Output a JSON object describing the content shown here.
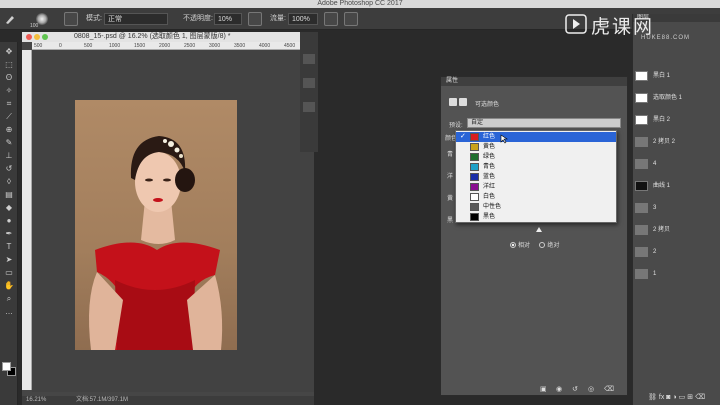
{
  "app": {
    "window_title": "Adobe Photoshop CC 2017"
  },
  "options_bar": {
    "brush_size": "100",
    "mode_label": "模式:",
    "mode_value": "正常",
    "opacity_label": "不透明度:",
    "opacity_value": "10%",
    "flow_label": "流量:",
    "flow_value": "100%"
  },
  "document": {
    "tab_title": "0808_15-.psd @ 16.2% (选取颜色 1, 图层蒙版/8) *",
    "zoom": "16.21%",
    "doc_size": "文档:57.1M/397.1M",
    "ruler_labels": [
      "500",
      "0",
      "500",
      "1000",
      "1500",
      "2000",
      "2500",
      "3000",
      "3500",
      "4000",
      "4500"
    ]
  },
  "properties": {
    "header": "属性",
    "title": "可选颜色",
    "preset_label": "预设:",
    "preset_value": "自定",
    "color_label": "颜色:",
    "side_labels": [
      "青",
      "洋",
      "黄",
      "黑"
    ],
    "colors": [
      {
        "name": "红色",
        "swatch": "#d81e1e",
        "selected": true
      },
      {
        "name": "黄色",
        "swatch": "#c8a21a",
        "selected": false
      },
      {
        "name": "绿色",
        "swatch": "#1e6e2e",
        "selected": false
      },
      {
        "name": "青色",
        "swatch": "#1fa1c8",
        "selected": false
      },
      {
        "name": "蓝色",
        "swatch": "#1a2fa8",
        "selected": false
      },
      {
        "name": "洋红",
        "swatch": "#8a1090",
        "selected": false
      },
      {
        "name": "白色",
        "swatch": "#ffffff",
        "selected": false
      },
      {
        "name": "中性色",
        "swatch": "#5a5a5a",
        "selected": false
      },
      {
        "name": "黑色",
        "swatch": "#000000",
        "selected": false
      }
    ],
    "method_relative": "相对",
    "method_absolute": "绝对"
  },
  "layers": {
    "tab_label": "图层",
    "rows": [
      {
        "name": "黑白 1"
      },
      {
        "name": "选取颜色 1"
      },
      {
        "name": "黑白 2"
      },
      {
        "name": "2 拷贝 2"
      },
      {
        "name": "4"
      },
      {
        "name": "曲线 1"
      },
      {
        "name": "3"
      },
      {
        "name": "2 拷贝"
      },
      {
        "name": "2"
      },
      {
        "name": "1"
      }
    ]
  },
  "watermark": {
    "brand": "虎课网",
    "url": "HUKE88.COM"
  }
}
